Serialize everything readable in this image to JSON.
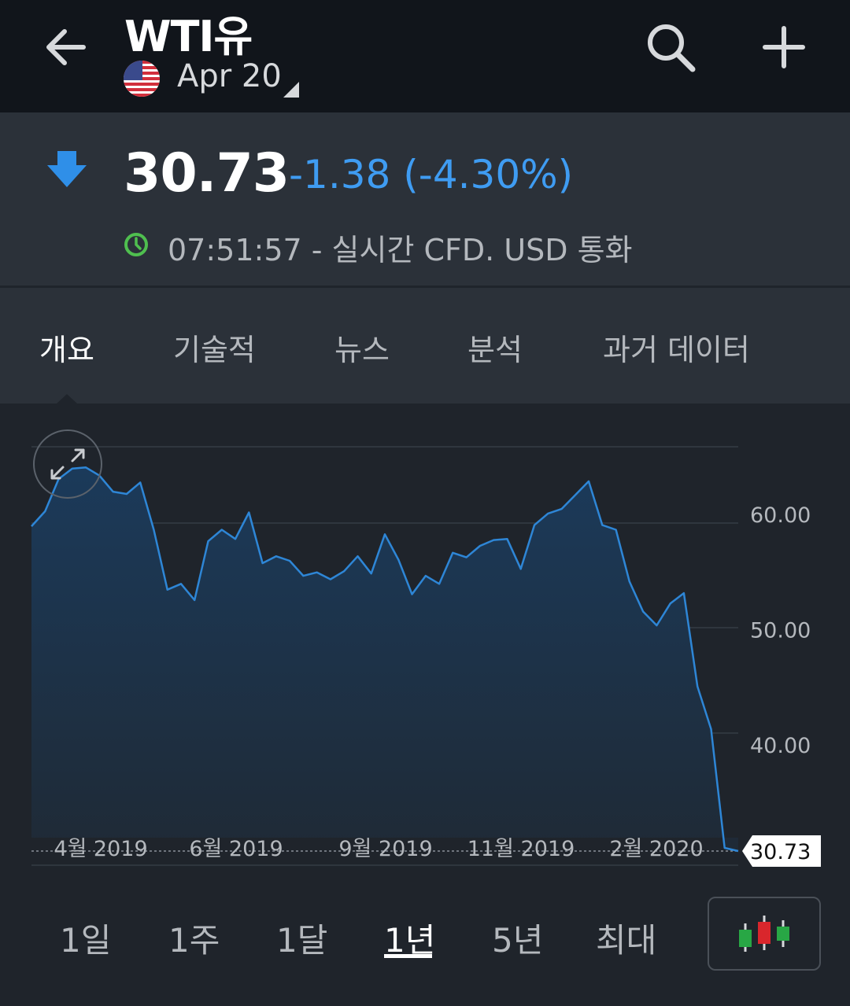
{
  "header": {
    "title": "WTI유",
    "contract": "Apr 20",
    "icons": {
      "back": "arrow-left-icon",
      "search": "search-icon",
      "add": "plus-icon",
      "flag": "us-flag-icon"
    }
  },
  "quote": {
    "price": "30.73",
    "change": "-1.38 (-4.30%)",
    "time_info": "07:51:57 - 실시간 CFD. USD 통화",
    "colors": {
      "change": "#3f9cf2",
      "down_arrow": "#2f8fe8",
      "clock": "#4fbf4f"
    }
  },
  "tabs": [
    {
      "label": "개요",
      "active": true
    },
    {
      "label": "기술적",
      "active": false
    },
    {
      "label": "뉴스",
      "active": false
    },
    {
      "label": "분석",
      "active": false
    },
    {
      "label": "과거 데이터",
      "active": false
    }
  ],
  "chart_data": {
    "type": "area",
    "title": "",
    "xlabel": "",
    "ylabel": "",
    "ylim": [
      29.5,
      67.5
    ],
    "yticks": [
      "40.00",
      "50.00",
      "60.00"
    ],
    "xticks": [
      "4월 2019",
      "6월 2019",
      "9월 2019",
      "11월 2019",
      "2월 2020"
    ],
    "last_value_label": "30.73",
    "grid": true,
    "series": [
      {
        "values": [
          58.9,
          60.2,
          63.0,
          63.9,
          64.0,
          63.3,
          61.9,
          61.7,
          62.7,
          58.6,
          53.4,
          53.9,
          52.5,
          57.6,
          58.6,
          57.8,
          60.1,
          55.7,
          56.3,
          55.9,
          54.6,
          54.9,
          54.3,
          55.0,
          56.3,
          54.8,
          58.2,
          56.0,
          53.0,
          54.6,
          53.9,
          56.6,
          56.2,
          57.2,
          57.7,
          57.8,
          55.2,
          59.0,
          60.0,
          60.4,
          61.6,
          62.8,
          59.0,
          58.6,
          54.1,
          51.5,
          50.3,
          52.2,
          53.1,
          45.0,
          41.3,
          31.0,
          30.73
        ]
      }
    ],
    "colors": {
      "line": "#2e86d6",
      "fill_top": "#1b3a5a",
      "fill_bottom": "#1f2a36"
    }
  },
  "ranges": [
    {
      "label": "1일",
      "active": false
    },
    {
      "label": "1주",
      "active": false
    },
    {
      "label": "1달",
      "active": false
    },
    {
      "label": "1년",
      "active": true
    },
    {
      "label": "5년",
      "active": false
    },
    {
      "label": "최대",
      "active": false
    }
  ],
  "chart_type_button": {
    "icon": "candlestick-icon"
  }
}
